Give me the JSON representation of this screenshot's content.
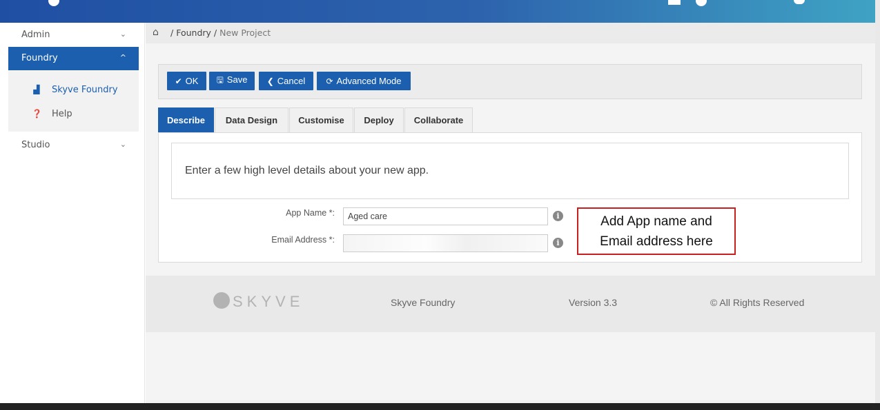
{
  "sidebar": {
    "items": [
      {
        "label": "Admin",
        "chevron": "chevron-down-icon"
      },
      {
        "label": "Foundry",
        "chevron": "chevron-up-icon"
      },
      {
        "label": "Studio",
        "chevron": "chevron-down-icon"
      }
    ],
    "submenu": [
      {
        "label": "Skyve Foundry",
        "icon": "factory-icon"
      },
      {
        "label": "Help",
        "icon": "question-circle-icon"
      }
    ],
    "chev_down": "⌄",
    "chev_up": "^"
  },
  "breadcrumb": {
    "sep1": "/",
    "foundry": "Foundry",
    "sep2": "/",
    "current": "New Project"
  },
  "toolbar": {
    "ok_label": "OK",
    "save_label": "Save",
    "cancel_label": "Cancel",
    "advanced_label": "Advanced Mode"
  },
  "tabs": [
    "Describe",
    "Data Design",
    "Customise",
    "Deploy",
    "Collaborate"
  ],
  "intro": "Enter a few high level details about your new app.",
  "form": {
    "app_name_label": "App Name *:",
    "app_name_value": "Aged care",
    "email_label": "Email Address *:"
  },
  "callout": {
    "line1": "Add App name and",
    "line2": "Email address here"
  },
  "footer": {
    "logo": "SKYVE",
    "product": "Skyve Foundry",
    "version": "Version 3.3",
    "rights": "© All Rights Reserved"
  },
  "colors": {
    "primary": "#1b5fae",
    "callout_border": "#c81e1e"
  }
}
